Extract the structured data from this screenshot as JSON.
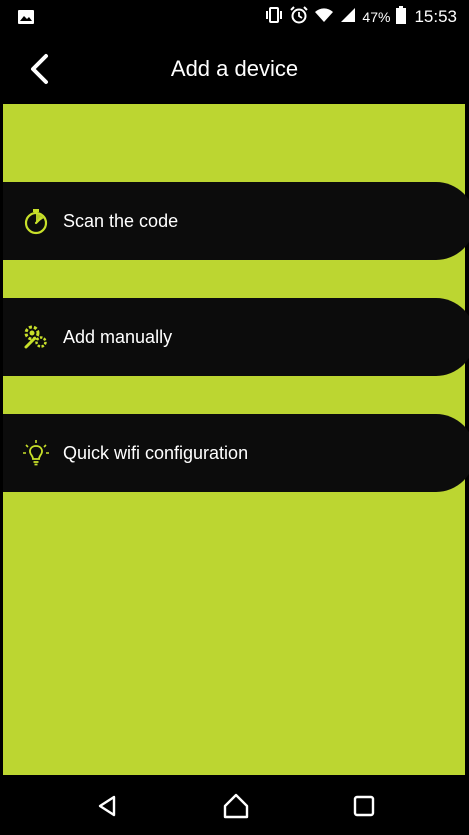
{
  "status_bar": {
    "battery_percent": "47%",
    "time": "15:53",
    "icons": [
      "image-icon",
      "vibrate-icon",
      "alarm-icon",
      "wifi-icon",
      "signal-icon",
      "battery-icon"
    ]
  },
  "header": {
    "title": "Add a device",
    "back_icon": "back-chevron-icon"
  },
  "menu": {
    "items": [
      {
        "label": "Scan the code",
        "icon": "stopwatch-icon"
      },
      {
        "label": "Add manually",
        "icon": "gears-wrench-icon"
      },
      {
        "label": "Quick wifi configuration",
        "icon": "lightbulb-icon"
      }
    ]
  },
  "nav_bar": {
    "buttons": [
      "back-triangle-icon",
      "home-icon",
      "recents-square-icon"
    ]
  },
  "colors": {
    "background": "#bcd631",
    "accent": "#c8e02a",
    "item_bg": "#0c0c0c",
    "bars": "#000000"
  }
}
